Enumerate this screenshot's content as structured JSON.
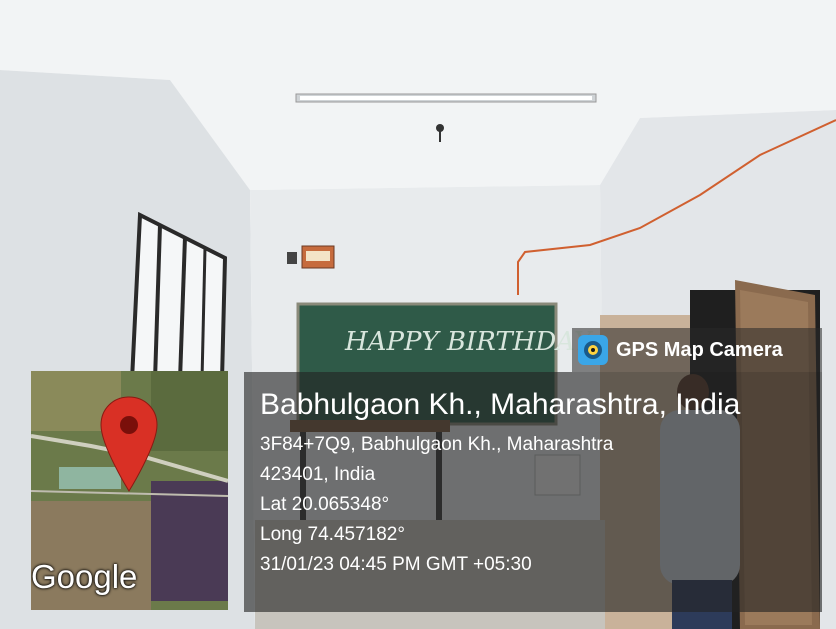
{
  "overlay": {
    "app_label": "GPS Map Camera",
    "place_title": "Babhulgaon Kh., Maharashtra, India",
    "address_line_1": "3F84+7Q9, Babhulgaon Kh., Maharashtra",
    "address_line_2": "423401, India",
    "latitude": "Lat 20.065348°",
    "longitude": "Long 74.457182°",
    "datetime": "31/01/23 04:45 PM GMT +05:30",
    "map_logo": "Google"
  },
  "scene": {
    "chalkboard_text": "HAPPY BIRTHDAY"
  },
  "colors": {
    "wall": "#e9ecee",
    "chalkboard": "#2f5a48",
    "door": "#8a6a4e",
    "pin": "#d93025"
  }
}
